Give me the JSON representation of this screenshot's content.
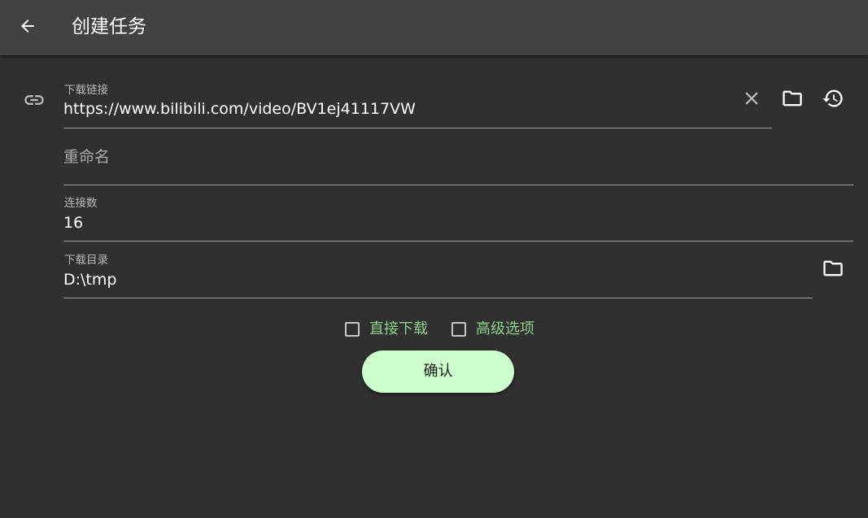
{
  "appbar": {
    "title": "创建任务",
    "back_icon": "arrow-back-icon"
  },
  "form": {
    "url": {
      "label": "下载链接",
      "value": "https://www.bilibili.com/video/BV1ej41117VW",
      "icons": [
        "link-icon",
        "clear-icon",
        "folder-icon",
        "history-icon"
      ]
    },
    "rename": {
      "placeholder": "重命名",
      "value": ""
    },
    "connections": {
      "label": "连接数",
      "value": "16"
    },
    "directory": {
      "label": "下载目录",
      "value": "D:\\tmp",
      "icon": "folder-icon"
    }
  },
  "options": {
    "direct_download": {
      "label": "直接下载",
      "checked": false
    },
    "advanced": {
      "label": "高级选项",
      "checked": false
    }
  },
  "confirm_label": "确认",
  "colors": {
    "background": "#303030",
    "appbar": "#424242",
    "accent_text": "#8fd08f",
    "button": "#ccffcc"
  }
}
